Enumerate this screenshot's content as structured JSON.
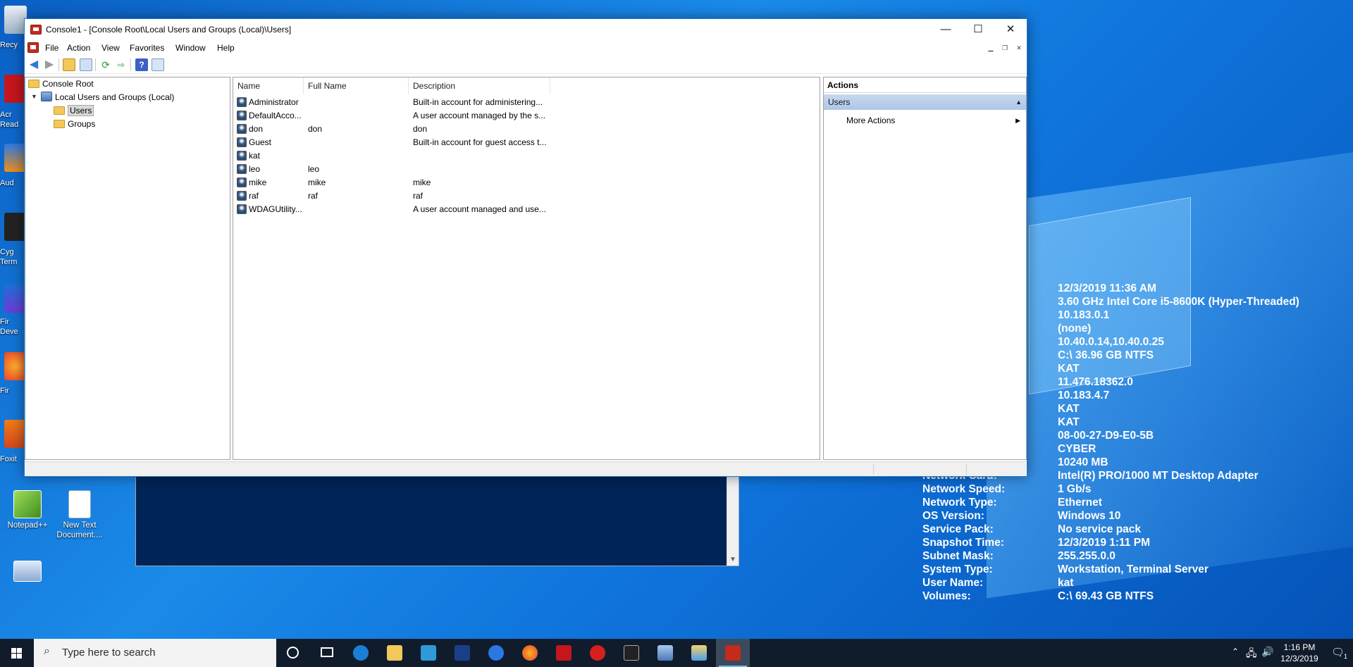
{
  "desktop": {
    "icons": [
      {
        "name": "recycle-bin",
        "label": "Recy"
      },
      {
        "name": "acrobat-reader",
        "label": "Acr\nRead"
      },
      {
        "name": "audacity",
        "label": "Aud"
      },
      {
        "name": "cygwin",
        "label": "Cyg\nTerm"
      },
      {
        "name": "firefox-dev",
        "label": "Fir\nDeve"
      },
      {
        "name": "firefox",
        "label": "Fir"
      },
      {
        "name": "foxit",
        "label": "Foxit"
      },
      {
        "name": "notepad-plus-plus",
        "label": "Notepad++"
      },
      {
        "name": "new-text-document",
        "label": "New Text\nDocument...."
      }
    ],
    "notepad_label": "Notepad++",
    "newtext_label1": "New Text",
    "newtext_label2": "Document....",
    "left_labels": [
      "Recy",
      "Acr",
      "Read",
      "Aud",
      "Cyg",
      "Term",
      "Fir",
      "Deve",
      "Fir",
      "Foxit"
    ]
  },
  "bginfo": {
    "rows": [
      {
        "label": "",
        "value": "12/3/2019 11:36 AM"
      },
      {
        "label": "",
        "value": "3.60 GHz Intel Core i5-8600K (Hyper-Threaded)"
      },
      {
        "label": "",
        "value": "10.183.0.1"
      },
      {
        "label": "",
        "value": "(none)"
      },
      {
        "label": "",
        "value": "10.40.0.14,10.40.0.25"
      },
      {
        "label": "",
        "value": "C:\\ 36.96 GB NTFS"
      },
      {
        "label": "",
        "value": "KAT"
      },
      {
        "label": "",
        "value": "11.476.18362.0"
      },
      {
        "label": "",
        "value": "10.183.4.7"
      },
      {
        "label": "",
        "value": "KAT"
      },
      {
        "label": "",
        "value": "KAT"
      },
      {
        "label": "",
        "value": "08-00-27-D9-E0-5B"
      },
      {
        "label": "",
        "value": "CYBER"
      },
      {
        "label": "",
        "value": "10240 MB"
      },
      {
        "label": "Network Card:",
        "value": "Intel(R) PRO/1000 MT Desktop Adapter"
      },
      {
        "label": "Network Speed:",
        "value": "1 Gb/s"
      },
      {
        "label": "Network Type:",
        "value": "Ethernet"
      },
      {
        "label": "OS Version:",
        "value": "Windows 10"
      },
      {
        "label": "Service Pack:",
        "value": "No service pack"
      },
      {
        "label": "Snapshot Time:",
        "value": "12/3/2019 1:11 PM"
      },
      {
        "label": "Subnet Mask:",
        "value": "255.255.0.0"
      },
      {
        "label": "System Type:",
        "value": "Workstation, Terminal Server"
      },
      {
        "label": "User Name:",
        "value": "kat"
      },
      {
        "label": "Volumes:",
        "value": "C:\\ 69.43 GB NTFS"
      }
    ]
  },
  "window": {
    "title": "Console1 - [Console Root\\Local Users and Groups (Local)\\Users]",
    "minimize_glyph": "—",
    "maximize_glyph": "☐",
    "close_glyph": "✕"
  },
  "menu": {
    "items": [
      "File",
      "Action",
      "View",
      "Favorites",
      "Window",
      "Help"
    ]
  },
  "tree": {
    "root": "Console Root",
    "snapin": "Local Users and Groups (Local)",
    "users": "Users",
    "groups": "Groups"
  },
  "list": {
    "columns": [
      "Name",
      "Full Name",
      "Description"
    ],
    "rows": [
      {
        "name": "Administrator",
        "full_name": "",
        "description": "Built-in account for administering..."
      },
      {
        "name": "DefaultAcco...",
        "full_name": "",
        "description": "A user account managed by the s..."
      },
      {
        "name": "don",
        "full_name": "don",
        "description": "don"
      },
      {
        "name": "Guest",
        "full_name": "",
        "description": "Built-in account for guest access t..."
      },
      {
        "name": "kat",
        "full_name": "",
        "description": ""
      },
      {
        "name": "leo",
        "full_name": "leo",
        "description": ""
      },
      {
        "name": "mike",
        "full_name": "mike",
        "description": "mike"
      },
      {
        "name": "raf",
        "full_name": "raf",
        "description": "raf"
      },
      {
        "name": "WDAGUtility...",
        "full_name": "",
        "description": "A user account managed and use..."
      }
    ]
  },
  "actions": {
    "header": "Actions",
    "section": "Users",
    "more": "More Actions"
  },
  "taskbar": {
    "search_placeholder": "Type here to search",
    "time": "1:16 PM",
    "date": "12/3/2019",
    "notification_count": "1",
    "accent": "#76b9ed"
  }
}
